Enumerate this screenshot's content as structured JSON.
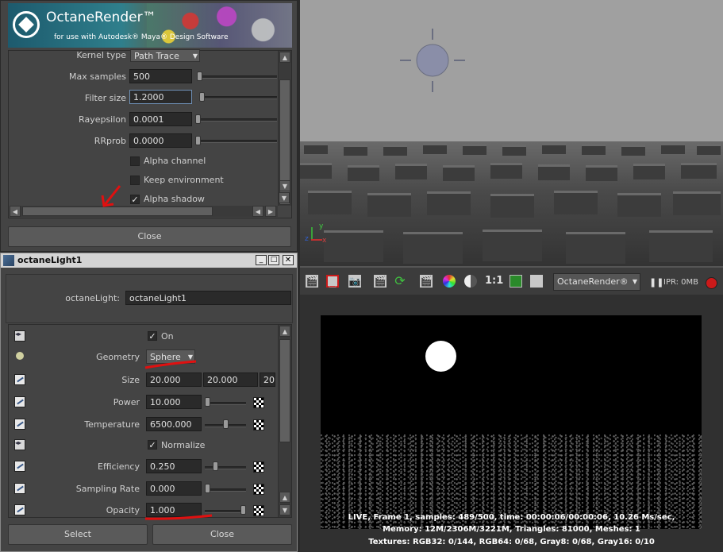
{
  "octane_settings": {
    "banner": {
      "title": "OctaneRender™",
      "subtitle": "for use with Autodesk® Maya® Design Software"
    },
    "kernel_type": {
      "label": "Kernel type",
      "value": "Path Trace"
    },
    "max_samples": {
      "label": "Max samples",
      "value": "500"
    },
    "filter_size": {
      "label": "Filter size",
      "value": "1.2000"
    },
    "rayepsilon": {
      "label": "Rayepsilon",
      "value": "0.0001"
    },
    "rrprob": {
      "label": "RRprob",
      "value": "0.0000"
    },
    "alpha_channel": {
      "label": "Alpha channel",
      "checked": false
    },
    "keep_environment": {
      "label": "Keep environment",
      "checked": false
    },
    "alpha_shadow": {
      "label": "Alpha shadow",
      "checked": true
    },
    "close_label": "Close"
  },
  "light_window": {
    "title": "octaneLight1",
    "node_label": "octaneLight:",
    "node_value": "octaneLight1",
    "on": {
      "label": "On",
      "checked": true
    },
    "geometry": {
      "label": "Geometry",
      "value": "Sphere"
    },
    "size": {
      "label": "Size",
      "values": [
        "20.000",
        "20.000",
        "20"
      ]
    },
    "power": {
      "label": "Power",
      "value": "10.000"
    },
    "temperature": {
      "label": "Temperature",
      "value": "6500.000"
    },
    "normalize": {
      "label": "Normalize",
      "checked": true
    },
    "efficiency": {
      "label": "Efficiency",
      "value": "0.250"
    },
    "sampling_rate": {
      "label": "Sampling Rate",
      "value": "0.000"
    },
    "opacity": {
      "label": "Opacity",
      "value": "1.000"
    },
    "select_label": "Select",
    "close_label": "Close",
    "check_glyph": "✓"
  },
  "render_view": {
    "ratio_label": "1:1",
    "renderer": "OctaneRender®",
    "ipr": "IPR: 0MB",
    "status": {
      "line1": "LIVE, Frame 1, samples: 489/500, time: 00:00:06/00:00:06, 10.26 Ms/sec,",
      "line2": "Memory: 12M/2306M/3221M, Triangles: 81000, Meshes: 1",
      "line3": "Textures: RGB32: 0/144, RGB64: 0/68, Gray8: 0/68, Gray16: 0/10"
    }
  },
  "viewport": {
    "axis_x": "x",
    "axis_y": "y",
    "axis_z": "z"
  },
  "colors": {
    "annotation_red": "#e01010",
    "record_red": "#cc1a1a",
    "titlebar_blue": "#4a6e96"
  }
}
